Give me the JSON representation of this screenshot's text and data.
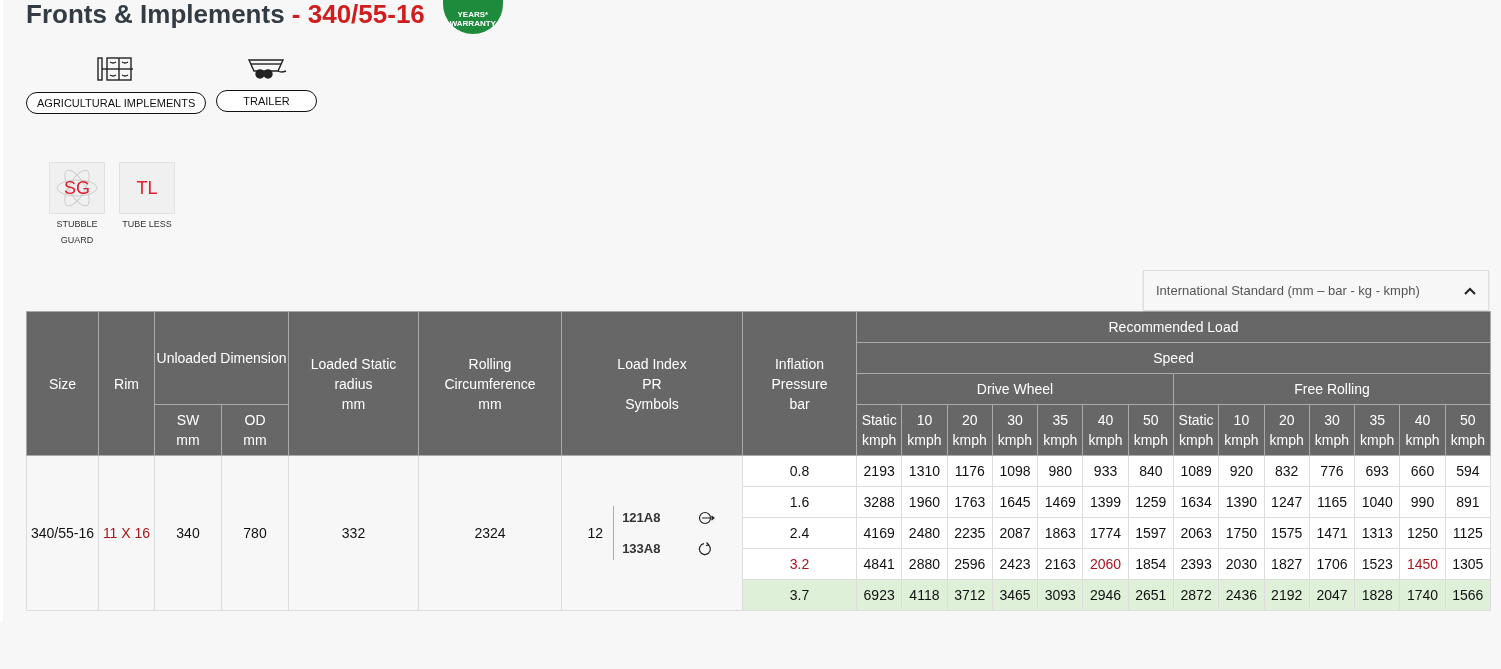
{
  "title": {
    "text": "Fronts & Implements",
    "size": "- 340/55-16"
  },
  "warranty_badge": {
    "line_1": "YEARS*",
    "line_2": "WARRANTY"
  },
  "applications": [
    {
      "label": "AGRICULTURAL IMPLEMENTS",
      "kind": "implements"
    },
    {
      "label": "TRAILER",
      "kind": "trailer"
    }
  ],
  "features": [
    {
      "code": "SG",
      "label": "STUBBLE GUARD",
      "kind": "atom"
    },
    {
      "code": "TL",
      "label": "TUBE LESS",
      "kind": "plain"
    }
  ],
  "unit_dropdown": {
    "value": "International Standard (mm – bar - kg - kmph)"
  },
  "table": {
    "headers": {
      "size": "Size",
      "rim": "Rim",
      "unloaded": "Unloaded Dimension",
      "sw": "SW\nmm",
      "od": "OD\nmm",
      "loaded_radius": "Loaded Static\nradius\nmm",
      "rolling": "Rolling\nCircumference\nmm",
      "load_index": "Load Index\nPR\nSymbols",
      "inflation": "Inflation\nPressure\nbar",
      "recommended": "Recommended Load",
      "speed": "Speed",
      "groups": [
        "Drive Wheel",
        "Free Rolling"
      ],
      "speeds": [
        "Static\nkmph",
        "10\nkmph",
        "20\nkmph",
        "30\nkmph",
        "35\nkmph",
        "40\nkmph",
        "50\nkmph",
        "Static\nkmph",
        "10\nkmph",
        "20\nkmph",
        "30\nkmph",
        "35\nkmph",
        "40\nkmph",
        "50\nkmph"
      ]
    },
    "tyre": {
      "size": "340/55-16",
      "rim": "11 X 16",
      "sw": "340",
      "od": "780",
      "loaded_radius": "332",
      "rolling": "2324",
      "pr": "12",
      "symbols": [
        {
          "code": "121A8",
          "kind": "drive"
        },
        {
          "code": "133A8",
          "kind": "rolling"
        }
      ]
    },
    "rows": [
      {
        "pressure": "0.8",
        "alert": false,
        "selected": false,
        "loads": [
          {
            "value": "2193",
            "alert": false
          },
          {
            "value": "1310",
            "alert": false
          },
          {
            "value": "1176",
            "alert": false
          },
          {
            "value": "1098",
            "alert": false
          },
          {
            "value": "980",
            "alert": false
          },
          {
            "value": "933",
            "alert": false
          },
          {
            "value": "840",
            "alert": false
          },
          {
            "value": "1089",
            "alert": false
          },
          {
            "value": "920",
            "alert": false
          },
          {
            "value": "832",
            "alert": false
          },
          {
            "value": "776",
            "alert": false
          },
          {
            "value": "693",
            "alert": false
          },
          {
            "value": "660",
            "alert": false
          },
          {
            "value": "594",
            "alert": false
          }
        ]
      },
      {
        "pressure": "1.6",
        "alert": false,
        "selected": false,
        "loads": [
          {
            "value": "3288",
            "alert": false
          },
          {
            "value": "1960",
            "alert": false
          },
          {
            "value": "1763",
            "alert": false
          },
          {
            "value": "1645",
            "alert": false
          },
          {
            "value": "1469",
            "alert": false
          },
          {
            "value": "1399",
            "alert": false
          },
          {
            "value": "1259",
            "alert": false
          },
          {
            "value": "1634",
            "alert": false
          },
          {
            "value": "1390",
            "alert": false
          },
          {
            "value": "1247",
            "alert": false
          },
          {
            "value": "1165",
            "alert": false
          },
          {
            "value": "1040",
            "alert": false
          },
          {
            "value": "990",
            "alert": false
          },
          {
            "value": "891",
            "alert": false
          }
        ]
      },
      {
        "pressure": "2.4",
        "alert": false,
        "selected": false,
        "loads": [
          {
            "value": "4169",
            "alert": false
          },
          {
            "value": "2480",
            "alert": false
          },
          {
            "value": "2235",
            "alert": false
          },
          {
            "value": "2087",
            "alert": false
          },
          {
            "value": "1863",
            "alert": false
          },
          {
            "value": "1774",
            "alert": false
          },
          {
            "value": "1597",
            "alert": false
          },
          {
            "value": "2063",
            "alert": false
          },
          {
            "value": "1750",
            "alert": false
          },
          {
            "value": "1575",
            "alert": false
          },
          {
            "value": "1471",
            "alert": false
          },
          {
            "value": "1313",
            "alert": false
          },
          {
            "value": "1250",
            "alert": false
          },
          {
            "value": "1125",
            "alert": false
          }
        ]
      },
      {
        "pressure": "3.2",
        "alert": true,
        "selected": false,
        "loads": [
          {
            "value": "4841",
            "alert": false
          },
          {
            "value": "2880",
            "alert": false
          },
          {
            "value": "2596",
            "alert": false
          },
          {
            "value": "2423",
            "alert": false
          },
          {
            "value": "2163",
            "alert": false
          },
          {
            "value": "2060",
            "alert": true
          },
          {
            "value": "1854",
            "alert": false
          },
          {
            "value": "2393",
            "alert": false
          },
          {
            "value": "2030",
            "alert": false
          },
          {
            "value": "1827",
            "alert": false
          },
          {
            "value": "1706",
            "alert": false
          },
          {
            "value": "1523",
            "alert": false
          },
          {
            "value": "1450",
            "alert": true
          },
          {
            "value": "1305",
            "alert": false
          }
        ]
      },
      {
        "pressure": "3.7",
        "alert": false,
        "selected": true,
        "loads": [
          {
            "value": "6923",
            "alert": false
          },
          {
            "value": "4118",
            "alert": false
          },
          {
            "value": "3712",
            "alert": false
          },
          {
            "value": "3465",
            "alert": false
          },
          {
            "value": "3093",
            "alert": false
          },
          {
            "value": "2946",
            "alert": false
          },
          {
            "value": "2651",
            "alert": false
          },
          {
            "value": "2872",
            "alert": false
          },
          {
            "value": "2436",
            "alert": false
          },
          {
            "value": "2192",
            "alert": false
          },
          {
            "value": "2047",
            "alert": false
          },
          {
            "value": "1828",
            "alert": false
          },
          {
            "value": "1740",
            "alert": false
          },
          {
            "value": "1566",
            "alert": false
          }
        ]
      }
    ]
  }
}
